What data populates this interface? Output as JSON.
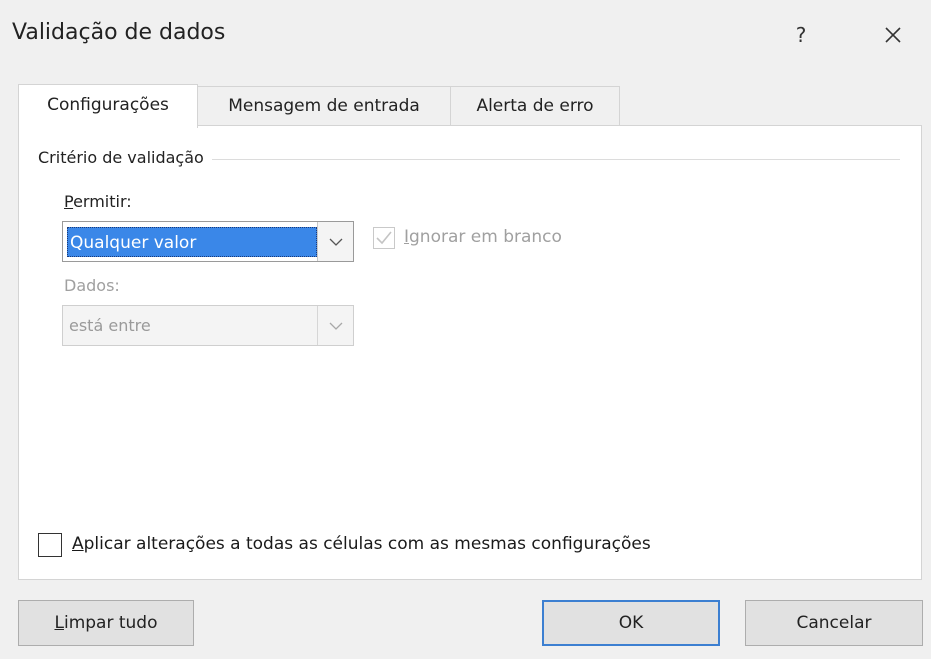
{
  "window": {
    "title": "Validação de dados",
    "help_label": "?"
  },
  "tabs": [
    {
      "label": "Configurações",
      "active": true
    },
    {
      "label": "Mensagem de entrada",
      "active": false
    },
    {
      "label": "Alerta de erro",
      "active": false
    }
  ],
  "criteria": {
    "group_label": "Critério de validação",
    "permitir": {
      "label_mnemonic": "P",
      "label_rest": "ermitir:",
      "value": "Qualquer valor"
    },
    "ignorar": {
      "label_mnemonic": "I",
      "label_rest": "gnorar em branco",
      "checked": true,
      "enabled": false
    },
    "dados": {
      "label": "Dados:",
      "value": "está entre",
      "enabled": false
    }
  },
  "apply_all": {
    "label_mnemonic": "A",
    "label_rest": "plicar alterações a todas as células com as mesmas configurações",
    "checked": false
  },
  "buttons": {
    "limpar_mnemonic": "L",
    "limpar_rest": "impar tudo",
    "ok": "OK",
    "cancelar": "Cancelar"
  },
  "icons": {
    "close": "close-icon",
    "dropdown": "chevron-down-icon",
    "check": "checkmark-icon"
  },
  "colors": {
    "selection": "#3a87e8",
    "ok_border": "#3c7fd1",
    "disabled_text": "#a0a0a0"
  }
}
